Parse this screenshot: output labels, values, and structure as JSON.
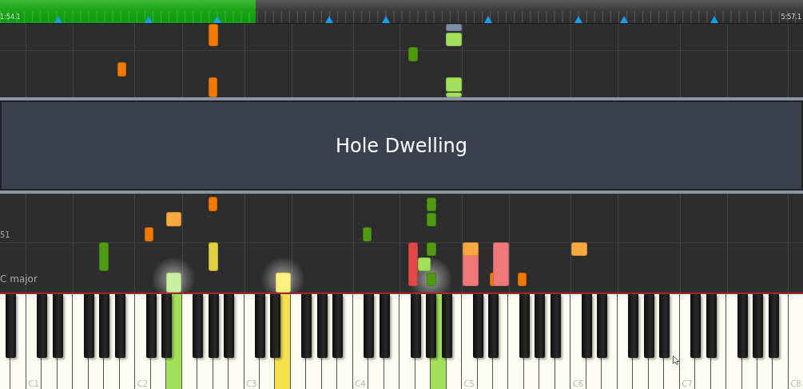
{
  "progress": {
    "level": 0.318,
    "elapsed": "1:54.1",
    "total": "5:57.1"
  },
  "song_title": "Hole Dwelling",
  "measure": "51",
  "key_signature": "C major",
  "notes": [
    {
      "color": "#f07a00"
    },
    {
      "color": "#f07a00"
    },
    {
      "color": "#f07a00"
    },
    {
      "color": "#4f9a10"
    },
    {
      "color": "#7a90a8"
    },
    {
      "color": "#a3e05a"
    },
    {
      "color": "#a3e05a"
    },
    {
      "color": "#a3e05a"
    },
    {
      "color": "#f07a00"
    },
    {
      "color": "#f8a840"
    },
    {
      "color": "#f07a00"
    },
    {
      "color": "#4f9a10"
    },
    {
      "color": "#e0d040"
    },
    {
      "color": "#4f9a10"
    },
    {
      "color": "#4f9a10"
    },
    {
      "color": "#4f9a10"
    },
    {
      "color": "#4f9a10"
    },
    {
      "color": "#e04848"
    },
    {
      "color": "#a3e05a"
    },
    {
      "color": "#4f9a10"
    },
    {
      "color": "#f07878"
    },
    {
      "color": "#f8a840"
    },
    {
      "color": "#f07a00"
    },
    {
      "color": "#f07878"
    },
    {
      "color": "#f07a00"
    },
    {
      "color": "#f8a840"
    },
    {
      "color": "#c8f0a0"
    },
    {
      "color": "#fff080"
    }
  ],
  "white_keys": [
    {
      "pressed": false
    },
    {
      "pressed": false
    },
    {
      "label": "C1",
      "pressed": false
    },
    {
      "pressed": false
    },
    {
      "pressed": false
    },
    {
      "pressed": false
    },
    {
      "pressed": false
    },
    {
      "pressed": false
    },
    {
      "pressed": false
    },
    {
      "label": "C2",
      "pressed": false
    },
    {
      "pressed": false
    },
    {
      "pressed": true,
      "color": "#a3e05a"
    },
    {
      "pressed": false
    },
    {
      "pressed": false
    },
    {
      "pressed": false
    },
    {
      "pressed": false
    },
    {
      "label": "C3",
      "pressed": false
    },
    {
      "pressed": false
    },
    {
      "pressed": true,
      "color": "#f5e050"
    },
    {
      "pressed": false
    },
    {
      "pressed": false
    },
    {
      "pressed": false
    },
    {
      "pressed": false
    },
    {
      "label": "C4",
      "pressed": false
    },
    {
      "pressed": false
    },
    {
      "pressed": false
    },
    {
      "pressed": false
    },
    {
      "pressed": false
    },
    {
      "pressed": true,
      "color": "#a3e05a"
    },
    {
      "pressed": false
    },
    {
      "label": "C5",
      "pressed": false
    },
    {
      "pressed": false
    },
    {
      "pressed": false
    },
    {
      "pressed": false
    },
    {
      "pressed": false
    },
    {
      "pressed": false
    },
    {
      "pressed": false
    },
    {
      "label": "C6",
      "pressed": false
    },
    {
      "pressed": false
    },
    {
      "pressed": false
    },
    {
      "pressed": false
    },
    {
      "pressed": false
    },
    {
      "pressed": false
    },
    {
      "pressed": false
    },
    {
      "label": "C7",
      "pressed": false
    },
    {
      "pressed": false
    },
    {
      "pressed": false
    },
    {
      "pressed": false
    },
    {
      "pressed": false
    },
    {
      "pressed": false
    },
    {
      "pressed": false
    },
    {
      "label": "C8",
      "pressed": false
    }
  ]
}
